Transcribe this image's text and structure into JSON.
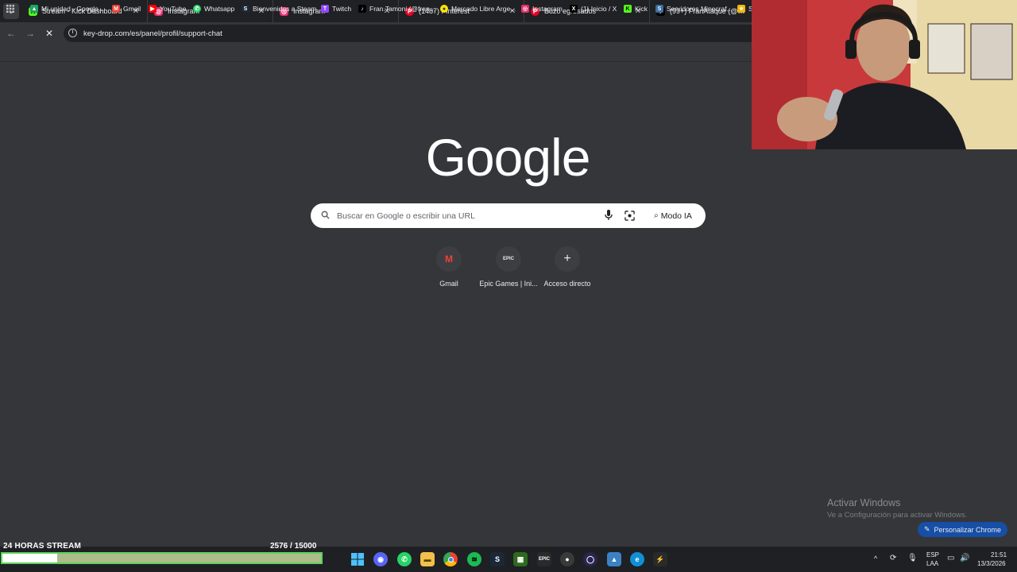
{
  "tabs": [
    {
      "title": "Stream - Kick Dashboard",
      "icon": "kick-icon",
      "color": "#53fc18"
    },
    {
      "title": "Instagram",
      "icon": "instagram-icon",
      "color": "#e1306c"
    },
    {
      "title": "Instagram",
      "icon": "instagram-icon",
      "color": "#e1306c"
    },
    {
      "title": "(1487) Pinterest",
      "icon": "pinterest-icon",
      "color": "#e60023"
    },
    {
      "title": "Buzo egresados",
      "icon": "pinterest-icon",
      "color": "#e60023"
    },
    {
      "title": "(99+) FranAtaque (@franataque",
      "icon": "tiktok-icon",
      "color": "#000000"
    }
  ],
  "address_bar": {
    "url": "key-drop.com/es/panel/profil/support-chat"
  },
  "bookmarks": [
    {
      "label": "Mi unidad - Google...",
      "icon": "google-drive-icon"
    },
    {
      "label": "Gmail",
      "icon": "gmail-icon"
    },
    {
      "label": "YouTube",
      "icon": "youtube-icon"
    },
    {
      "label": "Whatsapp",
      "icon": "whatsapp-icon"
    },
    {
      "label": "Bienvenidos a Steam",
      "icon": "steam-icon"
    },
    {
      "label": "Twitch",
      "icon": "twitch-icon"
    },
    {
      "label": "Fran.Tamoni (@fran...",
      "icon": "tiktok-icon"
    },
    {
      "label": "Mercado Libre Arge...",
      "icon": "mercadolibre-icon"
    },
    {
      "label": "Instagram",
      "icon": "instagram-icon"
    },
    {
      "label": "(1) Inicio / X",
      "icon": "x-icon"
    },
    {
      "label": "Kick",
      "icon": "kick-icon"
    },
    {
      "label": "Servidores Minecraf...",
      "icon": "minecraft-icon"
    },
    {
      "label": "S",
      "icon": "bookmark-icon"
    }
  ],
  "google": {
    "logo": "Google",
    "search_placeholder": "Buscar en Google o escribir una URL",
    "ai_mode_label": "Modo IA"
  },
  "shortcuts": [
    {
      "label": "Gmail",
      "icon": "gmail-icon",
      "glyph": "M"
    },
    {
      "label": "Epic Games | Ini...",
      "icon": "epic-games-icon",
      "glyph": "EPIC"
    },
    {
      "label": "Acceso directo",
      "icon": "plus-icon",
      "glyph": "+"
    }
  ],
  "watermark": {
    "title": "Activar Windows",
    "subtitle": "Ve a Configuración para activar Windows."
  },
  "customize_button": {
    "label": "Personalizar Chrome"
  },
  "stream_goal": {
    "title": "24 HORAS STREAM",
    "count": "2576 / 15000",
    "progress_fraction": 0.172
  },
  "taskbar": {
    "lang_primary": "ESP",
    "lang_secondary": "LAA",
    "time": "21:51",
    "date": "13/3/2026"
  },
  "colors": {
    "page_bg": "#35363a",
    "tabstrip_bg": "#202124",
    "customize_bg": "#174ea6",
    "goal_border": "#5cd35c"
  }
}
